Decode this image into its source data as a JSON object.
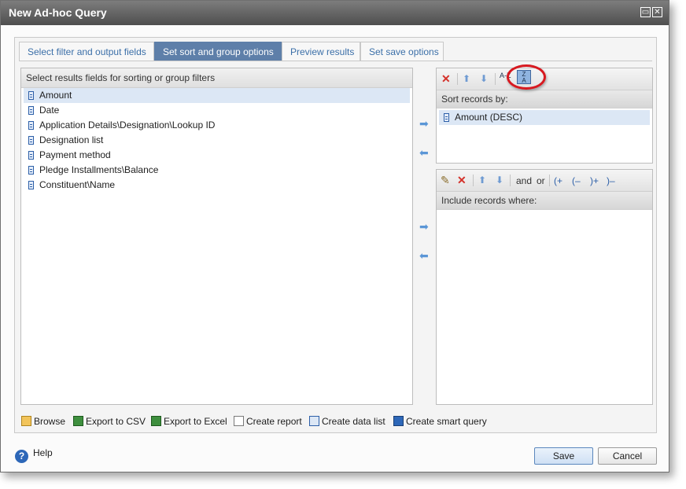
{
  "window": {
    "title": "New Ad-hoc Query"
  },
  "tabs": [
    {
      "label": "Select filter and output fields",
      "active": false
    },
    {
      "label": "Set sort and group options",
      "active": true
    },
    {
      "label": "Preview results",
      "active": false
    },
    {
      "label": "Set save options",
      "active": false
    }
  ],
  "left_pane": {
    "header": "Select results fields for sorting or group filters",
    "fields": [
      "Amount",
      "Date",
      "Application Details\\Designation\\Lookup ID",
      "Designation list",
      "Payment method",
      "Pledge Installments\\Balance",
      "Constituent\\Name"
    ],
    "selected_index": 0
  },
  "sort_pane": {
    "header": "Sort records by:",
    "items": [
      "Amount (DESC)"
    ],
    "toolbar": {
      "sort_az_icon": "A-Z",
      "sort_za_icon_top": "Z",
      "sort_za_icon_bottom": "A"
    }
  },
  "filter_pane": {
    "header": "Include records where:",
    "toolbar": {
      "and": "and",
      "or": "or",
      "open_paren": "(+",
      "open_paren_remove": "(–",
      "close_paren": ")+",
      "close_paren_remove": ")–"
    }
  },
  "actions": {
    "browse": "Browse",
    "export_csv": "Export to CSV",
    "export_excel": "Export to Excel",
    "create_report": "Create report",
    "create_data_list": "Create data list",
    "create_smart_query": "Create smart query"
  },
  "footer": {
    "help": "Help",
    "save": "Save",
    "cancel": "Cancel"
  },
  "colors": {
    "active_tab": "#5e7fa9",
    "link_blue": "#3b6fa8",
    "highlight_ring": "#d71920",
    "selection": "#dce7f5"
  }
}
